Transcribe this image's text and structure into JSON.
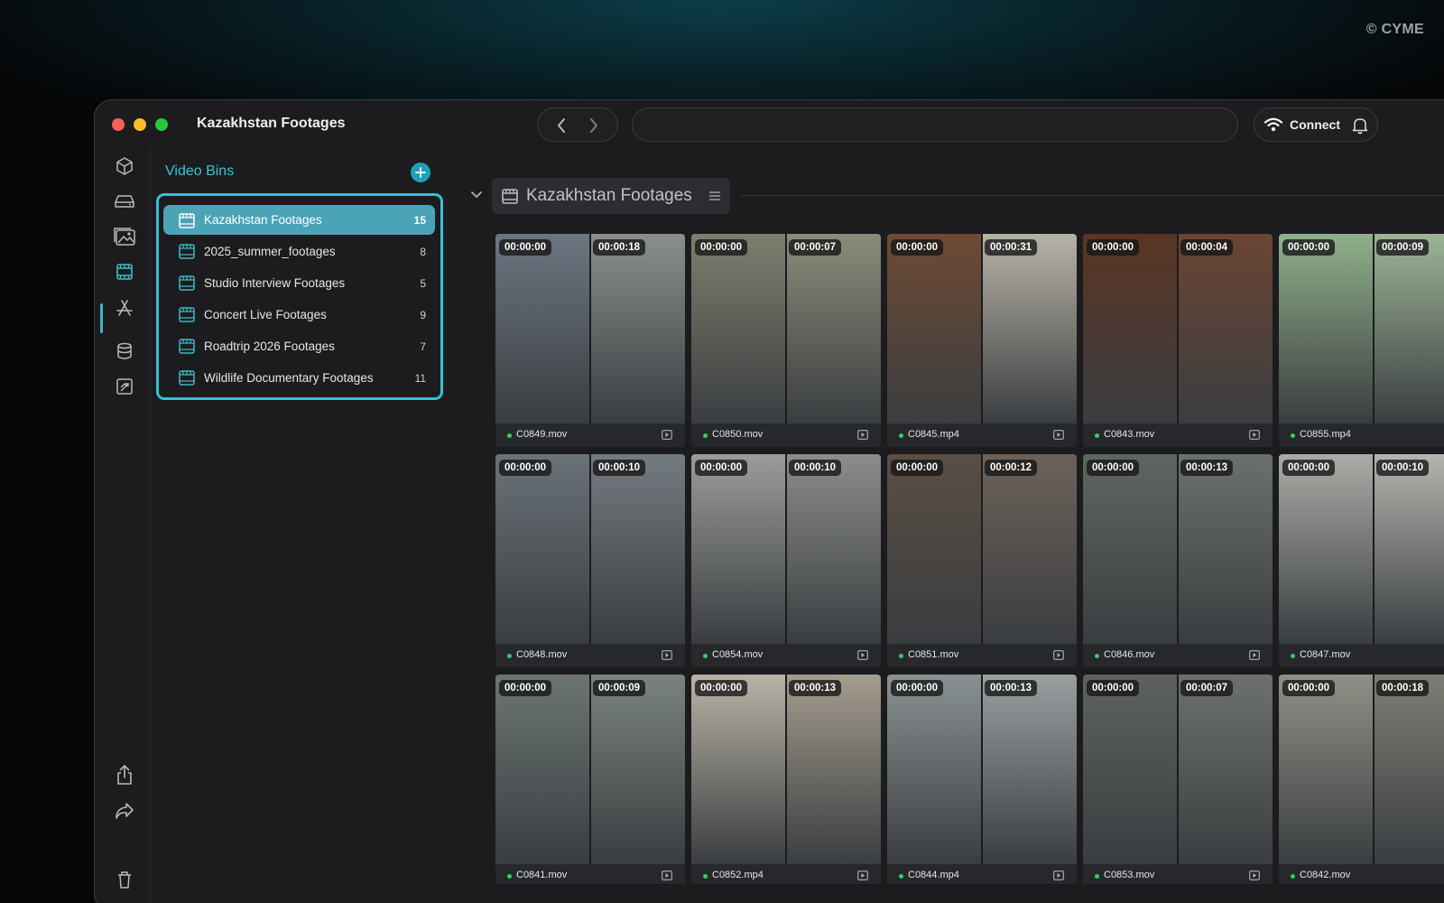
{
  "watermark": "© CYME",
  "window": {
    "title": "Kazakhstan Footages",
    "connect_label": "Connect"
  },
  "sidebar": {
    "title": "Video Bins",
    "bins": [
      {
        "label": "Kazakhstan Footages",
        "count": "15",
        "active": true
      },
      {
        "label": "2025_summer_footages",
        "count": "8"
      },
      {
        "label": "Studio Interview Footages",
        "count": "5"
      },
      {
        "label": "Concert Live Footages",
        "count": "9"
      },
      {
        "label": "Roadtrip 2026 Footages",
        "count": "7"
      },
      {
        "label": "Wildlife Documentary Footages",
        "count": "11"
      }
    ]
  },
  "main": {
    "header_title": "Kazakhstan Footages",
    "clips": [
      {
        "name": "C0849.mov",
        "start": "00:00:00",
        "end": "00:00:18",
        "colors": [
          "#6b7681",
          "#8a8f8e"
        ]
      },
      {
        "name": "C0850.mov",
        "start": "00:00:00",
        "end": "00:00:07",
        "colors": [
          "#7d7f6e",
          "#8c8c7a"
        ]
      },
      {
        "name": "C0845.mp4",
        "start": "00:00:00",
        "end": "00:00:31",
        "colors": [
          "#6e4a34",
          "#b7b2a6"
        ]
      },
      {
        "name": "C0843.mov",
        "start": "00:00:00",
        "end": "00:00:04",
        "colors": [
          "#5a3523",
          "#6b4533"
        ]
      },
      {
        "name": "C0855.mp4",
        "start": "00:00:00",
        "end": "00:00:09",
        "colors": [
          "#8fb08a",
          "#9cb596"
        ]
      },
      {
        "name": "C0848.mov",
        "start": "00:00:00",
        "end": "00:00:10",
        "colors": [
          "#6a7278",
          "#747b80"
        ]
      },
      {
        "name": "C0854.mov",
        "start": "00:00:00",
        "end": "00:00:10",
        "colors": [
          "#9a9c9a",
          "#8b8d8b"
        ]
      },
      {
        "name": "C0851.mov",
        "start": "00:00:00",
        "end": "00:00:12",
        "colors": [
          "#5a4e45",
          "#6c625a"
        ]
      },
      {
        "name": "C0846.mov",
        "start": "00:00:00",
        "end": "00:00:13",
        "colors": [
          "#5f6660",
          "#6a716b"
        ]
      },
      {
        "name": "C0847.mov",
        "start": "00:00:00",
        "end": "00:00:10",
        "colors": [
          "#a9aca6",
          "#b3b5af"
        ]
      },
      {
        "name": "C0841.mov",
        "start": "00:00:00",
        "end": "00:00:09",
        "colors": [
          "#6b7573",
          "#7a8380"
        ]
      },
      {
        "name": "C0852.mp4",
        "start": "00:00:00",
        "end": "00:00:13",
        "colors": [
          "#b9b3a6",
          "#a49c8e"
        ]
      },
      {
        "name": "C0844.mp4",
        "start": "00:00:00",
        "end": "00:00:13",
        "colors": [
          "#8a9193",
          "#99a0a0"
        ]
      },
      {
        "name": "C0853.mov",
        "start": "00:00:00",
        "end": "00:00:07",
        "colors": [
          "#5e625e",
          "#6d716c"
        ]
      },
      {
        "name": "C0842.mov",
        "start": "00:00:00",
        "end": "00:00:18",
        "colors": [
          "#8f9187",
          "#7d7f75"
        ]
      }
    ]
  }
}
